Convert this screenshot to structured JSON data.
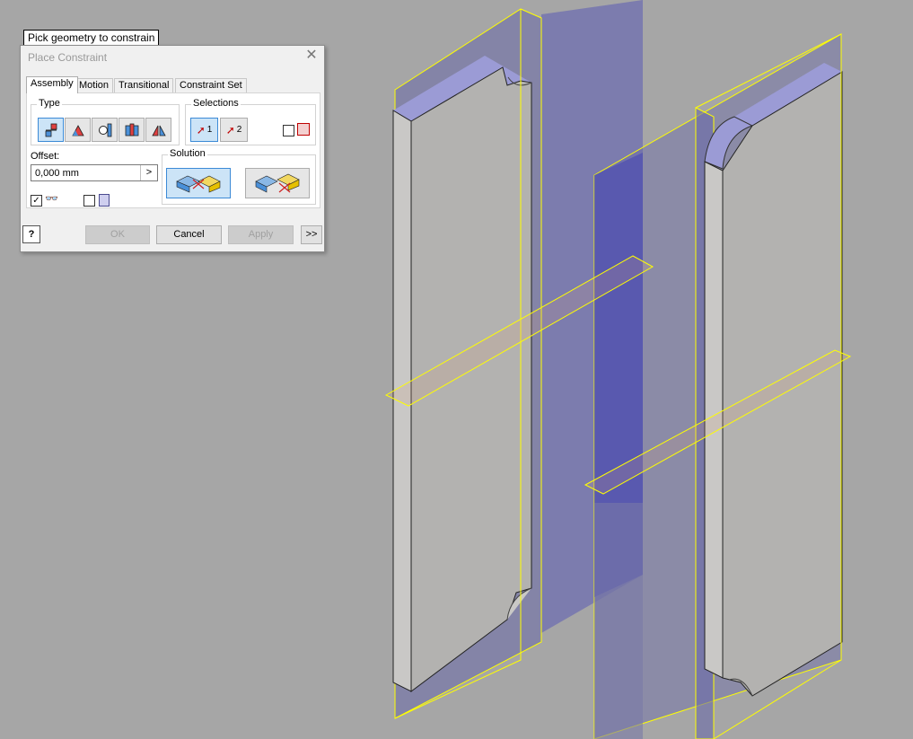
{
  "tooltip": "Pick geometry to constrain",
  "dialog": {
    "title": "Place Constraint",
    "tabs": [
      {
        "label": "Assembly"
      },
      {
        "label": "Motion"
      },
      {
        "label": "Transitional"
      },
      {
        "label": "Constraint Set"
      }
    ],
    "active_tab": "Assembly",
    "type_group_label": "Type",
    "type_buttons": [
      {
        "icon": "mate-icon",
        "selected": true
      },
      {
        "icon": "angle-icon",
        "selected": false
      },
      {
        "icon": "tangent-icon",
        "selected": false
      },
      {
        "icon": "insert-icon",
        "selected": false
      },
      {
        "icon": "symmetry-icon",
        "selected": false
      }
    ],
    "selections_group_label": "Selections",
    "selection_buttons": [
      {
        "label": "1",
        "icon": "select-first-arrow-icon"
      },
      {
        "label": "2",
        "icon": "select-second-arrow-icon"
      }
    ],
    "pick_part_first_checked": false,
    "offset_label": "Offset:",
    "offset_value": "0,000 mm",
    "offset_arrow": ">",
    "show_preview_checked": true,
    "predict_offset_checked": false,
    "solution_group_label": "Solution",
    "solution_buttons": [
      {
        "name": "mate",
        "selected": true
      },
      {
        "name": "flush",
        "selected": false
      }
    ],
    "buttons": {
      "ok": "OK",
      "cancel": "Cancel",
      "apply": "Apply",
      "more": ">>"
    },
    "help_icon": "help-icon"
  },
  "viewport": {
    "background_color": "#a6a6a6",
    "part_face_color": "#b2b1af",
    "plane_color": "#5a5ab4",
    "edge_highlight_color": "#ffff00"
  }
}
